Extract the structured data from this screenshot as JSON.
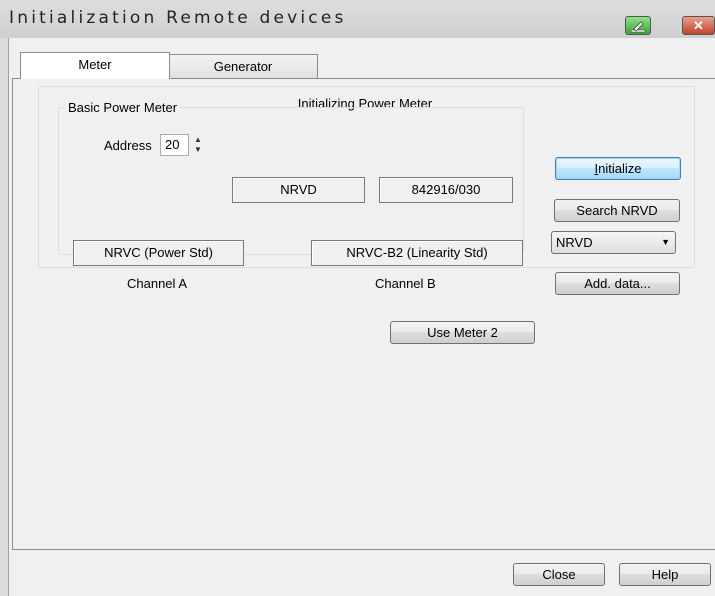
{
  "window": {
    "title": "Initialization  Remote devices"
  },
  "titlebar": {
    "edit_glyph": "✎",
    "close_glyph": "✕"
  },
  "tabs": [
    {
      "label": "Meter"
    },
    {
      "label": "Generator"
    }
  ],
  "panel": {
    "heading": "Initializing Power Meter",
    "group_label": "Basic Power Meter",
    "address_label": "Address",
    "address_value": "20",
    "device_field": "NRVD",
    "serial_field": "842916/030",
    "channel_a_field": "NRVC (Power Std)",
    "channel_b_field": "NRVC-B2 (Linearity Std)",
    "channel_a_label": "Channel A",
    "channel_b_label": "Channel B"
  },
  "buttons": {
    "initialize_prefix": "",
    "initialize_hotkey": "I",
    "initialize_rest": "nitialize",
    "search": "Search NRVD",
    "add_data": "Add. data...",
    "use_meter2": "Use Meter 2",
    "close": "Close",
    "help": "Help"
  },
  "combo": {
    "selected": "NRVD",
    "arrow": "▼"
  },
  "spinner": {
    "up": "▲",
    "down": "▼"
  }
}
